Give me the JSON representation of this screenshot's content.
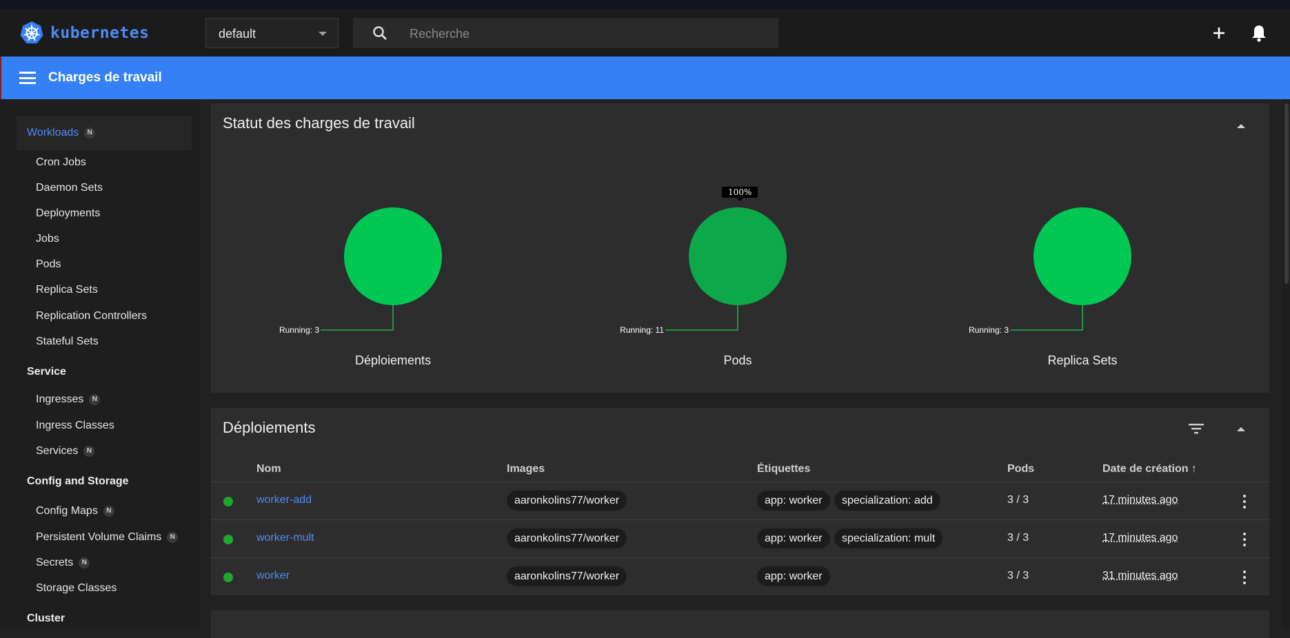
{
  "app": {
    "logo_text": "kubernetes",
    "namespace": "default",
    "search_placeholder": "Recherche",
    "page_title": "Charges de travail"
  },
  "sidebar": {
    "workloads": {
      "label": "Workloads",
      "badge": "N"
    },
    "workload_items": [
      "Cron Jobs",
      "Daemon Sets",
      "Deployments",
      "Jobs",
      "Pods",
      "Replica Sets",
      "Replication Controllers",
      "Stateful Sets"
    ],
    "service": {
      "label": "Service",
      "items": [
        {
          "label": "Ingresses",
          "badge": "N"
        },
        {
          "label": "Ingress Classes",
          "badge": ""
        },
        {
          "label": "Services",
          "badge": "N"
        }
      ]
    },
    "config": {
      "label": "Config and Storage",
      "items": [
        {
          "label": "Config Maps",
          "badge": "N"
        },
        {
          "label": "Persistent Volume Claims",
          "badge": "N"
        },
        {
          "label": "Secrets",
          "badge": "N"
        },
        {
          "label": "Storage Classes",
          "badge": ""
        }
      ]
    },
    "cluster": {
      "label": "Cluster"
    }
  },
  "status_card": {
    "title": "Statut des charges de travail",
    "tooltip": "100%",
    "charts": [
      {
        "caption": "Déploiements",
        "slice_label": "Running: 3",
        "value": 3,
        "color": "#00c853"
      },
      {
        "caption": "Pods",
        "slice_label": "Running: 11",
        "value": 11,
        "color": "#0ca84a"
      },
      {
        "caption": "Replica Sets",
        "slice_label": "Running: 3",
        "value": 3,
        "color": "#00c853"
      }
    ]
  },
  "deployments": {
    "title": "Déploiements",
    "columns": {
      "name": "Nom",
      "images": "Images",
      "labels": "Étiquettes",
      "pods": "Pods",
      "created": "Date de création ↑"
    },
    "rows": [
      {
        "name": "worker-add",
        "image": "aaronkolins77/worker",
        "labels": [
          "app: worker",
          "specialization: add"
        ],
        "pods": "3 / 3",
        "created": "17 minutes ago"
      },
      {
        "name": "worker-mult",
        "image": "aaronkolins77/worker",
        "labels": [
          "app: worker",
          "specialization: mult"
        ],
        "pods": "3 / 3",
        "created": "17 minutes ago"
      },
      {
        "name": "worker",
        "image": "aaronkolins77/worker",
        "labels": [
          "app: worker"
        ],
        "pods": "3 / 3",
        "created": "31 minutes ago"
      }
    ]
  },
  "colors": {
    "accent": "#3580f4",
    "running": "#1ea82e"
  }
}
